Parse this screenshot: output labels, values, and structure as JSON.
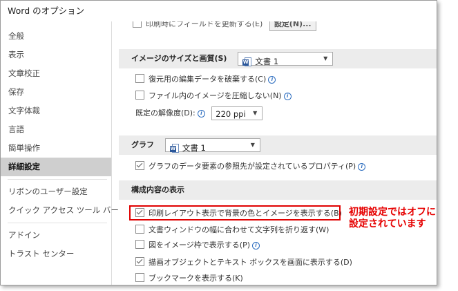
{
  "window": {
    "title": "Word のオプション"
  },
  "sidebar": {
    "items": [
      {
        "label": "全般"
      },
      {
        "label": "表示"
      },
      {
        "label": "文章校正"
      },
      {
        "label": "保存"
      },
      {
        "label": "文字体裁"
      },
      {
        "label": "言語"
      },
      {
        "label": "簡単操作"
      },
      {
        "label": "詳細設定",
        "active": true
      },
      {
        "label": "リボンのユーザー設定"
      },
      {
        "label": "クイック アクセス ツール バー"
      },
      {
        "label": "アドイン"
      },
      {
        "label": "トラスト センター"
      }
    ]
  },
  "content": {
    "top_partial": {
      "text": "印刷時にフィールドを更新する(E)",
      "button_label": "設定(N)..."
    },
    "image_section": {
      "title": "イメージのサイズと画質(S)",
      "document_selected": "文書 1",
      "options": [
        {
          "label": "復元用の編集データを破棄する(C)",
          "checked": false,
          "info": true
        },
        {
          "label": "ファイル内のイメージを圧縮しない(N)",
          "checked": false,
          "info": true
        }
      ],
      "resolution_label": "既定の解像度(D):",
      "resolution_value": "220 ppi"
    },
    "graph_section": {
      "title": "グラフ",
      "document_selected": "文書 1",
      "options": [
        {
          "label": "グラフのデータ要素の参照先が設定されているプロパティ(P)",
          "checked": true,
          "info": true
        }
      ]
    },
    "display_section": {
      "title": "構成内容の表示",
      "options": [
        {
          "label": "印刷レイアウト表示で背景の色とイメージを表示する(B)",
          "checked": true,
          "highlighted": true
        },
        {
          "label": "文書ウィンドウの幅に合わせて文字列を折り返す(W)",
          "checked": false
        },
        {
          "label": "図をイメージ枠で表示する(P)",
          "checked": false,
          "info": true
        },
        {
          "label": "描画オブジェクトとテキスト ボックスを画面に表示する(D)",
          "checked": true
        },
        {
          "label": "ブックマークを表示する(K)",
          "checked": false
        }
      ]
    }
  },
  "annotation": {
    "line1": "初期設定ではオフに",
    "line2": "設定されています",
    "color": "#e60000"
  },
  "icons": {
    "info": "i",
    "caret": "▼",
    "doc_letter": "W"
  }
}
